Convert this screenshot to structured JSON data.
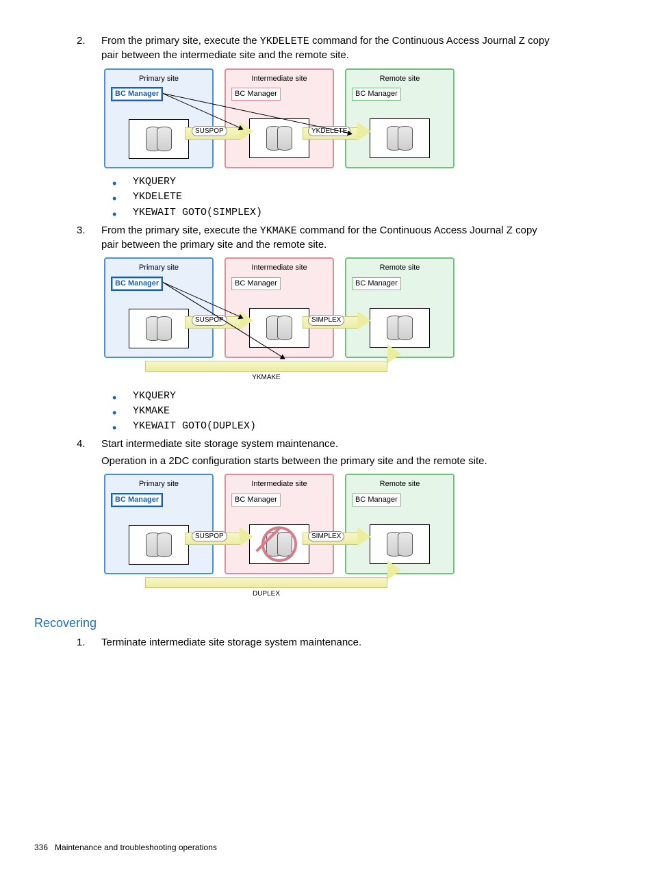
{
  "step2": {
    "text_a": "From the primary site, execute the ",
    "cmd": "YKDELETE",
    "text_b": " command for the Continuous Access Journal Z copy pair between the intermediate site and the remote site."
  },
  "step2_cmds": [
    "YKQUERY",
    "YKDELETE",
    "YKEWAIT GOTO(SIMPLEX)"
  ],
  "step3": {
    "text_a": "From the primary site, execute the ",
    "cmd": "YKMAKE",
    "text_b": " command for the Continuous Access Journal Z copy pair between the primary site and the remote site."
  },
  "step3_cmds": [
    "YKQUERY",
    "YKMAKE",
    "YKEWAIT GOTO(DUPLEX)"
  ],
  "step4": {
    "line1": "Start intermediate site storage system maintenance.",
    "line2": "Operation in a 2DC configuration starts between the primary site and the remote site."
  },
  "diagram": {
    "primary": "Primary site",
    "intermediate": "Intermediate site",
    "remote": "Remote site",
    "bcm": "BC Manager",
    "suspop": "SUSPOP",
    "ykdelete": "YKDELETE",
    "simplex": "SIMPLEX",
    "ykmake": "YKMAKE",
    "duplex": "DUPLEX"
  },
  "section": "Recovering",
  "recover_step1": "Terminate intermediate site storage system maintenance.",
  "footer": {
    "page": "336",
    "title": "Maintenance and troubleshooting operations"
  }
}
